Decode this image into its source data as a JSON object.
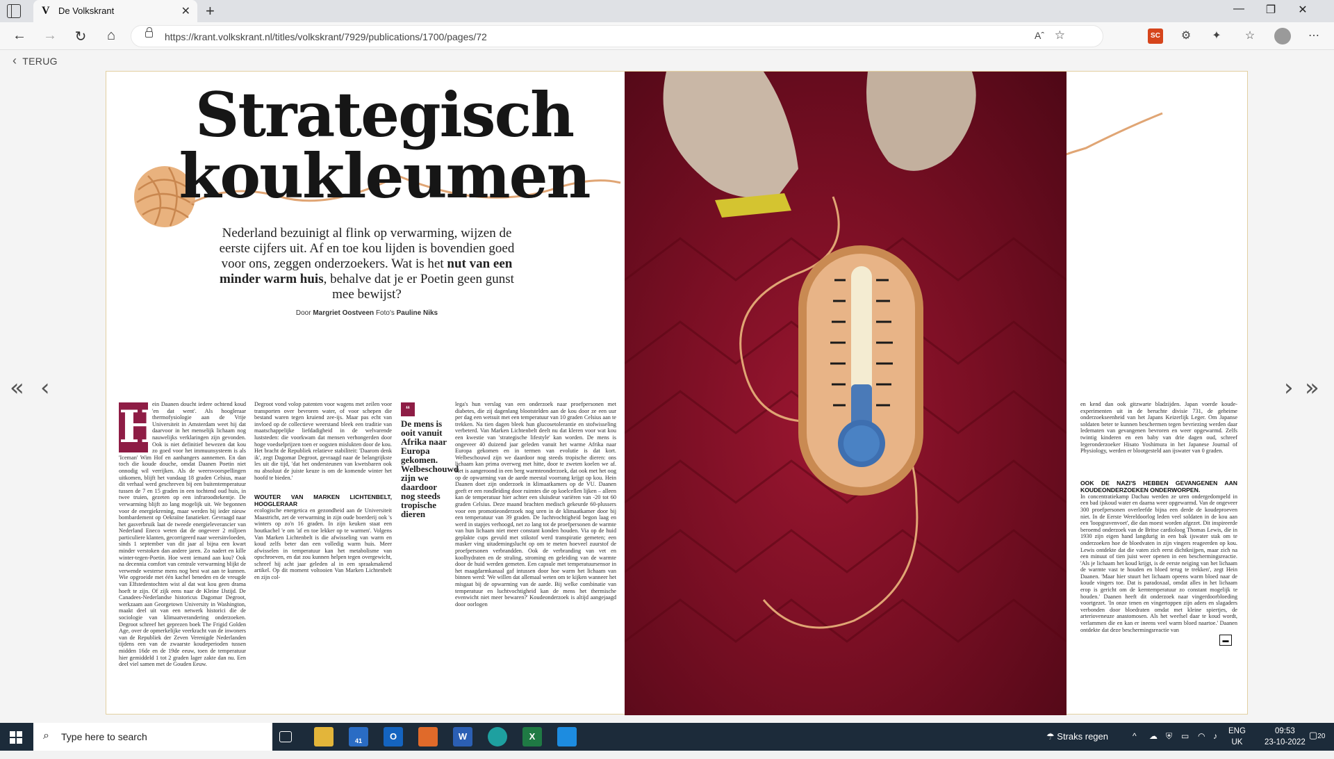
{
  "browser": {
    "tab_title": "De Volkskrant",
    "tab_favicon": "V",
    "url": "https://krant.volkskrant.nl/titles/volkskrant/7929/publications/1700/pages/72",
    "read_aloud": "Aˆ",
    "new_tab_symbol": "+",
    "close_tab_symbol": "✕",
    "window_controls": {
      "minimize": "—",
      "restore": "❐",
      "close": "✕"
    },
    "extension_badge": "SC"
  },
  "viewer": {
    "back_label": "TERUG",
    "pager": {
      "first": "«",
      "prev": "‹",
      "next": "›",
      "last": "»"
    }
  },
  "article": {
    "headline_1": "Strategisch",
    "headline_2": "koukleumen",
    "intro_1": "Nederland bezuinigt al flink op verwarming, wijzen de eerste cijfers uit. Af en toe kou lijden is bovendien goed voor ons, zeggen onderzoekers. Wat is het",
    "intro_bold": "nut van een minder warm huis",
    "intro_2": ", behalve dat je er Poetin geen gunst mee bewijst?",
    "byline_prefix": "Door",
    "author": "Margriet Oostveen",
    "photo_prefix": "Foto's",
    "photographer": "Pauline Niks",
    "dropcap": "H",
    "col1": "ein Daanen doucht iedere ochtend koud 'en dat went'. Als hoogleraar thermofysiologie aan de Vrije Universiteit in Amsterdam weet hij dat daarvoor in het menselijk lichaam nog nauwelijks verklaringen zijn gevonden. Ook is niet definitief bewezen dat kou zo goed voor het immuunsysteem is als 'Iceman' Wim Hof en aanhangers aannemen. En dan toch die koude douche, omdat Daanen Poetin niet onnodig wil verrijken. Als de weersvoorspellingen uitkomen, blijft het vandaag 18 graden Celsius, maar dit verhaal werd geschreven bij een buitentemperatuur tussen de 7 en 15 graden in een tochtend oud huis, in twee truien, gezeten op een infraroodtekentje. De verwarming blijft zo lang mogelijk uit. We begonnen voor de energiekrening, maar werden bij ieder nieuw bombardement op Oekraïne fanatieker. Gevraagd naar het gasverbruik laat de tweede energieleverancier van Nederland Eneco weten dat de ongeveer 2 miljoen particuliere klanten, gecorrigeerd naar weersinvloeden, sinds 1 september van dit jaar al bijna een kwart minder verstoken dan andere jaren. Zo nadert en kille winter-tegen-Poetin. Hoe went iemand aan kou? Ook na decennia comfort van centrale verwarming blijkt de verwende westerse mens nog best wat aan te kunnen. Wie opgroeide met één kachel beneden en de vreugde van Elfstedentochten wist al dat wat kou geen drama hoeft te zijn. Of zijk eens naar de Kleine IJstijd. De Canadees-Nederlandse historicus Dagomar Degroot, werkzaam aan Georgetown University in Washington, maakt deel uit van een netwerk historici die de sociologie van klimaatverandering onderzoeken. Degroot schreef het geprezen boek The Frigid Golden Age, over de opmerkelijke veerkracht van de inwoners van de Republiek der Zeven Verenigde Nederlanden tijdens een van de zwaarste koudeperioden tussen midden 16de en de 19de eeuw, toen de temperatuur hier gemiddeld 1 tot 2 graden lager zakte dan nu. Een deel viel samen met de Gouden Eeuw.",
    "col2": "Degroot vond volop patenten voor wagens met zeilen voor transporten over bevroren water, of voor schepen die bestand waren tegen kruiend zee-ijs. Maar pas echt van invloed op de collectieve weerstand bleek een traditie van maatschappelijke liefdadigheid in de welvarende luststeden: die voorkwam dat mensen verhongerden door hoge voedselprijzen toen er oogsten mislukten door de kou. Het bracht de Republiek relatieve stabiliteit: 'Daarom denk ik', zegt Dagomar Degroot, gevraagd naar de belangrijkste les uit die tijd, 'dat het ondersteunen van kwetsbaren ook nu absoluut de juiste keuze is om de komende winter het hoofd te bieden.'",
    "subhead_2": "WOUTER VAN MARKEN LICHTENBELT, HOOGLERAAR",
    "col2b": "ecologische energetica en gezondheid aan de Universiteit Maastricht, zet de verwarming in zijn oude boerderij ook 's winters op zo'n 16 graden. In zijn keuken staat een houtkachel 'e om 'af en toe lekker op te warmen'. Volgens Van Marken Lichtenbelt is die afwisseling van warm en koud zelfs beter dan een volledig warm huis. Meer afwisselen in temperatuur kan het metabolisme van opschroeven, en dat zou kunnen helpen tegen overgewicht, schreef hij acht jaar geleden al in een spraakmakend artikel. Op dit moment voltooien Van Marken Lichtenbelt en zijn col-",
    "quote_mark": "“",
    "quote": "De mens is ooit vanuit Afrika naar Europa gekomen. Welbeschouwd zijn we daardoor nog steeds tropische dieren",
    "col3": "lega's hun verslag van een onderzoek naar proefpersonen met diabetes, die zij dagenlang blootstelden aan de kou door ze een uur per dag een wetsuit met een temperatuur van 10 graden Celsius aan te trekken. Na tien dagen bleek hun glucosetolerantie en stofwisseling verbeterd. Van Marken Lichtenbelt deelt nu dat kleren voor wat kou een kwestie van 'strategische lifestyle' kan worden. De mens is ongeveer 40 duizend jaar geleden vanuit het warme Afrika naar Europa gekomen en in termen van evolutie is dat kort. Welbeschouwd zijn we daardoor nog steeds tropische dieren: ons lichaam kan prima overweg met hitte, door te zweten koelen we af. Het is aangeroond in een berg warmteonderzoek, dat ook met het oog op de opwarming van de aarde meestal voorrang krijgt op kou. Hein Daanen doet zijn onderzoek in klimaatkamers op de VU. Daanen geeft er een rondleiding door ruimtes die op koelcellen lijken – alleen kan de temperatuur hier achter een sluisdeur variëren van -20 tot 60 graden Celsius. Deze maand brachten medisch gekeurde 60-plussers voor een promotieonderzoek nog uren in de klimaatkamer door bij een temperatuur van 39 graden. De luchtvochtigheid begon laag en werd in stapjes verhoogd, net zo lang tot de proefpersonen de warmte van hun lichaam niet meer constant konden houden. Via op de huid geplakte cups gevuld met stikstof werd transpiratie gemeten; een masker ving uitademingslucht op om te meten hoeveel zuurstof de proefpersonen verbrandden. Ook de verbranding van vet en koolhydraten en de straling, stroming en geleiding van de warmte door de huid werden gemeten. Een capsule met temperatuursensor in het maagdarmkanaal gaf intussen door hoe warm het lichaam van binnen werd: 'We willen dat allemaal weten om te kijken wanneer het misgaat bij de opwarming van de aarde. Bij welke combinatie van temperatuur en luchtvochtigheid kan de mens het thermische evenwicht niet meer bewaren?' Koudeonderzoek is altijd aangejaagd door oorlogen",
    "col4": "en kend dan ook gitzwarte bladzijden. Japan voerde koude-experimenten uit in de beruchte divisie 731, de geheime onderzoekseenheid van het Japans Keizerlijk Leger. Om Japanse soldaten beter te kunnen beschermen tegen bevriezing werden daar ledematen van gevangenen bevroren en weer opgewarmd. Zelfs twintig kinderen en een baby van drie dagen oud, schreef legeronderzoeker Hisato Yoshimura in het Japanese Journal of Physiology, werden er blootgesteld aan ijswater van 0 graden.",
    "subhead_4": "OOK DE NAZI'S HEBBEN GEVANGENEN AAN KOUDEONDERZOEKEN ONDERWORPEN.",
    "col4b": "In concentratiekamp Dachau werden ze uren ondergedompeld in een bad ijskoud water en daarna weer opgewarmd. Van de ongeveer 300 proefpersonen overleefde bijna een derde de koudeproeven niet. In de Eerste Wereldoorlog leden veel soldaten in de kou aan een 'loopgravenvoet', die dan moest worden afgezet. Dit inspireerde beroemd onderzoek van de Britse cardioloog Thomas Lewis, die in 1930 zijn eigen hand langdurig in een bak ijswater stak om te onderzoeken hoe de bloedvaten in zijn vingers reageerden op kou. Lewis ontdekte dat die vaten zich eerst dichtknijpen, maar zich na een minuut of tien juist weer openen in een beschermingsreactie. 'Als je lichaam het koud krijgt, is de eerste neiging van het lichaam de warmte vast te houden en bloed terug te trekken', zegt Hein Daanen. 'Maar hier stuurt het lichaam opeens warm bloed naar de koude vingers toe. Dat is paradoxaal, omdat alles in het lichaam erop is gericht om de kerntemperatuur zo constant mogelijk te houden.' Daanen heeft dit onderzoek naar vingerdoorbloeding voortgezet. 'In onze tenen en vingertoppen zijn aders en slagaders verbonden door bloedraten omdat met kleine spiertjes, de arterioveneuze anastomosen. Als het weefsel daar te koud wordt, verlammen die en kan er ineens veel warm bloed naartoe.' Daanen ontdekte dat deze beschermingsreactie van",
    "end_mark": "▬"
  },
  "taskbar": {
    "search_placeholder": "Type here to search",
    "outlook_badge": "41",
    "weather": "Straks regen",
    "lang_1": "ENG",
    "lang_2": "UK",
    "time": "09:53",
    "date": "23-10-2022",
    "notifications": "20"
  },
  "colors": {
    "accent": "#8e1d45",
    "page_border": "#e2cfa0",
    "taskbar": "#1c2b3a"
  }
}
